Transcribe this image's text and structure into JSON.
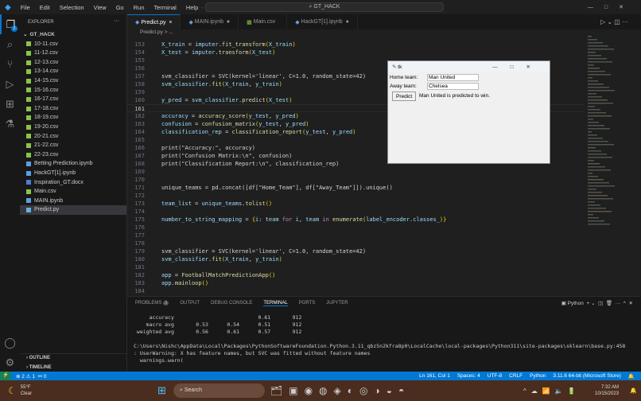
{
  "titlebar": {
    "menus": [
      "File",
      "Edit",
      "Selection",
      "View",
      "Go",
      "Run",
      "Terminal",
      "Help"
    ],
    "search": "GT_HACK"
  },
  "explorer": {
    "title": "EXPLORER",
    "folder": "GT_HACK",
    "badge": "2",
    "files": [
      {
        "name": "10-11.csv",
        "type": "csv"
      },
      {
        "name": "11-12.csv",
        "type": "csv"
      },
      {
        "name": "12-13.csv",
        "type": "csv"
      },
      {
        "name": "13-14.csv",
        "type": "csv"
      },
      {
        "name": "14-15.csv",
        "type": "csv"
      },
      {
        "name": "15-16.csv",
        "type": "csv"
      },
      {
        "name": "16-17.csv",
        "type": "csv"
      },
      {
        "name": "17-18.csv",
        "type": "csv"
      },
      {
        "name": "18-19.csv",
        "type": "csv"
      },
      {
        "name": "19-20.csv",
        "type": "csv"
      },
      {
        "name": "20-21.csv",
        "type": "csv"
      },
      {
        "name": "21-22.csv",
        "type": "csv"
      },
      {
        "name": "22-23.csv",
        "type": "csv"
      },
      {
        "name": "Betting Prediction.ipynb",
        "type": "nb"
      },
      {
        "name": "HackGT[1].ipynb",
        "type": "nb"
      },
      {
        "name": "Inspiration_GT.docx",
        "type": "doc"
      },
      {
        "name": "Main.csv",
        "type": "csv"
      },
      {
        "name": "MAIN.ipynb",
        "type": "nb"
      },
      {
        "name": "Predict.py",
        "type": "py"
      }
    ],
    "outline": "OUTLINE",
    "timeline": "TIMELINE"
  },
  "tabs": [
    {
      "label": "Predict.py",
      "mark": "×"
    },
    {
      "label": "MAIN.ipynb",
      "mark": "●"
    },
    {
      "label": "Main.csv",
      "mark": ""
    },
    {
      "label": "HackGT[1].ipynb",
      "mark": "●"
    }
  ],
  "breadcrumb": "Predict.py > ...",
  "code": [
    {
      "n": "153",
      "t": "X_train = imputer.fit_transform(X_train)"
    },
    {
      "n": "154",
      "t": "X_test = imputer.transform(X_test)"
    },
    {
      "n": "155",
      "t": ""
    },
    {
      "n": "156",
      "t": ""
    },
    {
      "n": "157",
      "t": "svm_classifier = SVC(kernel='linear', C=1.0, random_state=42)"
    },
    {
      "n": "158",
      "t": "svm_classifier.fit(X_train, y_train)"
    },
    {
      "n": "159",
      "t": ""
    },
    {
      "n": "160",
      "t": "y_pred = svm_classifier.predict(X_test)"
    },
    {
      "n": "161",
      "t": ""
    },
    {
      "n": "162",
      "t": "accuracy = accuracy_score(y_test, y_pred)"
    },
    {
      "n": "163",
      "t": "confusion = confusion_matrix(y_test, y_pred)"
    },
    {
      "n": "164",
      "t": "classification_rep = classification_report(y_test, y_pred)"
    },
    {
      "n": "165",
      "t": ""
    },
    {
      "n": "166",
      "t": "print(\"Accuracy:\", accuracy)"
    },
    {
      "n": "167",
      "t": "print(\"Confusion Matrix:\\n\", confusion)"
    },
    {
      "n": "168",
      "t": "print(\"Classification Report:\\n\", classification_rep)"
    },
    {
      "n": "169",
      "t": ""
    },
    {
      "n": "170",
      "t": ""
    },
    {
      "n": "171",
      "t": "unique_teams = pd.concat([df[\"Home_Team\"], df[\"Away_Team\"]]).unique()"
    },
    {
      "n": "172",
      "t": ""
    },
    {
      "n": "173",
      "t": "team_list = unique_teams.tolist()"
    },
    {
      "n": "174",
      "t": ""
    },
    {
      "n": "175",
      "t": "number_to_string_mapping = {i: team for i, team in enumerate(label_encoder.classes_)}"
    },
    {
      "n": "176",
      "t": ""
    },
    {
      "n": "177",
      "t": ""
    },
    {
      "n": "178",
      "t": ""
    },
    {
      "n": "179",
      "t": "svm_classifier = SVC(kernel='linear', C=1.0, random_state=42)"
    },
    {
      "n": "180",
      "t": "svm_classifier.fit(X_train, y_train)"
    },
    {
      "n": "181",
      "t": ""
    },
    {
      "n": "182",
      "t": "app = FootballMatchPredictionApp()"
    },
    {
      "n": "183",
      "t": "app.mainloop()"
    },
    {
      "n": "184",
      "t": ""
    }
  ],
  "panel": {
    "tabs": [
      "PROBLEMS",
      "OUTPUT",
      "DEBUG CONSOLE",
      "TERMINAL",
      "PORTS",
      "JUPYTER"
    ],
    "problems_count": "3",
    "shell": "Python",
    "terminal": [
      "     accuracy                           0.61       912",
      "    macro avg       0.53      0.54      0.51       912",
      " weighted avg       0.56      0.61      0.57       912",
      "",
      "C:\\Users\\Nishc\\AppData\\Local\\Packages\\PythonSoftwareFoundation.Python.3.11_qbz5n2kfra8p0\\LocalCache\\local-packages\\Python311\\site-packages\\sklearn\\base.py:458",
      ": UserWarning: X has feature names, but SVC was fitted without feature names",
      "  warnings.warn("
    ]
  },
  "status": {
    "errors": "2",
    "warnings": "1",
    "ports": "0",
    "position": "Ln 161, Col 1",
    "spaces": "Spaces: 4",
    "encoding": "UTF-8",
    "eol": "CRLF",
    "language": "Python",
    "interpreter": "3.11.6 64-bit (Microsoft Store)"
  },
  "tk": {
    "title": "tk",
    "home_label": "Home team:",
    "home_value": "Man United",
    "away_label": "Away team:",
    "away_value": "Chelsea",
    "button": "Predict",
    "result": "Man United is predicted to win."
  },
  "taskbar": {
    "temp": "55°F",
    "weather": "Clear",
    "search": "Search",
    "time": "7:32 AM",
    "date": "10/15/2023"
  }
}
